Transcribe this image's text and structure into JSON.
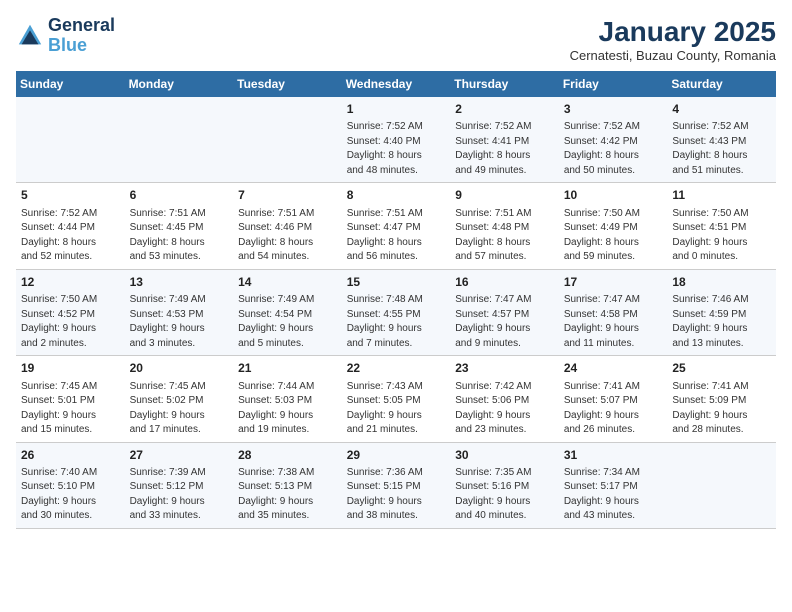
{
  "logo": {
    "line1": "General",
    "line2": "Blue"
  },
  "title": "January 2025",
  "subtitle": "Cernatesti, Buzau County, Romania",
  "weekdays": [
    "Sunday",
    "Monday",
    "Tuesday",
    "Wednesday",
    "Thursday",
    "Friday",
    "Saturday"
  ],
  "weeks": [
    [
      {
        "day": "",
        "lines": []
      },
      {
        "day": "",
        "lines": []
      },
      {
        "day": "",
        "lines": []
      },
      {
        "day": "1",
        "lines": [
          "Sunrise: 7:52 AM",
          "Sunset: 4:40 PM",
          "Daylight: 8 hours",
          "and 48 minutes."
        ]
      },
      {
        "day": "2",
        "lines": [
          "Sunrise: 7:52 AM",
          "Sunset: 4:41 PM",
          "Daylight: 8 hours",
          "and 49 minutes."
        ]
      },
      {
        "day": "3",
        "lines": [
          "Sunrise: 7:52 AM",
          "Sunset: 4:42 PM",
          "Daylight: 8 hours",
          "and 50 minutes."
        ]
      },
      {
        "day": "4",
        "lines": [
          "Sunrise: 7:52 AM",
          "Sunset: 4:43 PM",
          "Daylight: 8 hours",
          "and 51 minutes."
        ]
      }
    ],
    [
      {
        "day": "5",
        "lines": [
          "Sunrise: 7:52 AM",
          "Sunset: 4:44 PM",
          "Daylight: 8 hours",
          "and 52 minutes."
        ]
      },
      {
        "day": "6",
        "lines": [
          "Sunrise: 7:51 AM",
          "Sunset: 4:45 PM",
          "Daylight: 8 hours",
          "and 53 minutes."
        ]
      },
      {
        "day": "7",
        "lines": [
          "Sunrise: 7:51 AM",
          "Sunset: 4:46 PM",
          "Daylight: 8 hours",
          "and 54 minutes."
        ]
      },
      {
        "day": "8",
        "lines": [
          "Sunrise: 7:51 AM",
          "Sunset: 4:47 PM",
          "Daylight: 8 hours",
          "and 56 minutes."
        ]
      },
      {
        "day": "9",
        "lines": [
          "Sunrise: 7:51 AM",
          "Sunset: 4:48 PM",
          "Daylight: 8 hours",
          "and 57 minutes."
        ]
      },
      {
        "day": "10",
        "lines": [
          "Sunrise: 7:50 AM",
          "Sunset: 4:49 PM",
          "Daylight: 8 hours",
          "and 59 minutes."
        ]
      },
      {
        "day": "11",
        "lines": [
          "Sunrise: 7:50 AM",
          "Sunset: 4:51 PM",
          "Daylight: 9 hours",
          "and 0 minutes."
        ]
      }
    ],
    [
      {
        "day": "12",
        "lines": [
          "Sunrise: 7:50 AM",
          "Sunset: 4:52 PM",
          "Daylight: 9 hours",
          "and 2 minutes."
        ]
      },
      {
        "day": "13",
        "lines": [
          "Sunrise: 7:49 AM",
          "Sunset: 4:53 PM",
          "Daylight: 9 hours",
          "and 3 minutes."
        ]
      },
      {
        "day": "14",
        "lines": [
          "Sunrise: 7:49 AM",
          "Sunset: 4:54 PM",
          "Daylight: 9 hours",
          "and 5 minutes."
        ]
      },
      {
        "day": "15",
        "lines": [
          "Sunrise: 7:48 AM",
          "Sunset: 4:55 PM",
          "Daylight: 9 hours",
          "and 7 minutes."
        ]
      },
      {
        "day": "16",
        "lines": [
          "Sunrise: 7:47 AM",
          "Sunset: 4:57 PM",
          "Daylight: 9 hours",
          "and 9 minutes."
        ]
      },
      {
        "day": "17",
        "lines": [
          "Sunrise: 7:47 AM",
          "Sunset: 4:58 PM",
          "Daylight: 9 hours",
          "and 11 minutes."
        ]
      },
      {
        "day": "18",
        "lines": [
          "Sunrise: 7:46 AM",
          "Sunset: 4:59 PM",
          "Daylight: 9 hours",
          "and 13 minutes."
        ]
      }
    ],
    [
      {
        "day": "19",
        "lines": [
          "Sunrise: 7:45 AM",
          "Sunset: 5:01 PM",
          "Daylight: 9 hours",
          "and 15 minutes."
        ]
      },
      {
        "day": "20",
        "lines": [
          "Sunrise: 7:45 AM",
          "Sunset: 5:02 PM",
          "Daylight: 9 hours",
          "and 17 minutes."
        ]
      },
      {
        "day": "21",
        "lines": [
          "Sunrise: 7:44 AM",
          "Sunset: 5:03 PM",
          "Daylight: 9 hours",
          "and 19 minutes."
        ]
      },
      {
        "day": "22",
        "lines": [
          "Sunrise: 7:43 AM",
          "Sunset: 5:05 PM",
          "Daylight: 9 hours",
          "and 21 minutes."
        ]
      },
      {
        "day": "23",
        "lines": [
          "Sunrise: 7:42 AM",
          "Sunset: 5:06 PM",
          "Daylight: 9 hours",
          "and 23 minutes."
        ]
      },
      {
        "day": "24",
        "lines": [
          "Sunrise: 7:41 AM",
          "Sunset: 5:07 PM",
          "Daylight: 9 hours",
          "and 26 minutes."
        ]
      },
      {
        "day": "25",
        "lines": [
          "Sunrise: 7:41 AM",
          "Sunset: 5:09 PM",
          "Daylight: 9 hours",
          "and 28 minutes."
        ]
      }
    ],
    [
      {
        "day": "26",
        "lines": [
          "Sunrise: 7:40 AM",
          "Sunset: 5:10 PM",
          "Daylight: 9 hours",
          "and 30 minutes."
        ]
      },
      {
        "day": "27",
        "lines": [
          "Sunrise: 7:39 AM",
          "Sunset: 5:12 PM",
          "Daylight: 9 hours",
          "and 33 minutes."
        ]
      },
      {
        "day": "28",
        "lines": [
          "Sunrise: 7:38 AM",
          "Sunset: 5:13 PM",
          "Daylight: 9 hours",
          "and 35 minutes."
        ]
      },
      {
        "day": "29",
        "lines": [
          "Sunrise: 7:36 AM",
          "Sunset: 5:15 PM",
          "Daylight: 9 hours",
          "and 38 minutes."
        ]
      },
      {
        "day": "30",
        "lines": [
          "Sunrise: 7:35 AM",
          "Sunset: 5:16 PM",
          "Daylight: 9 hours",
          "and 40 minutes."
        ]
      },
      {
        "day": "31",
        "lines": [
          "Sunrise: 7:34 AM",
          "Sunset: 5:17 PM",
          "Daylight: 9 hours",
          "and 43 minutes."
        ]
      },
      {
        "day": "",
        "lines": []
      }
    ]
  ]
}
